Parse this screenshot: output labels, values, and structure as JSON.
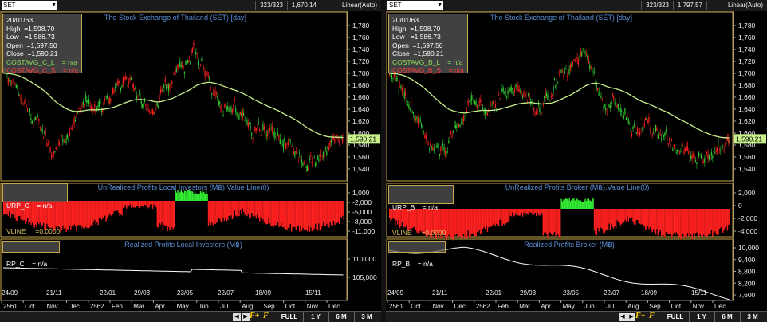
{
  "left": {
    "symbol": "SET",
    "count": "323/323",
    "last": "1,670.14",
    "scale": "Linear(Auto)",
    "main_title": "The Stock Exchange of Thailand (SET) [day]",
    "info": {
      "date": "20/01/63",
      "high": "High  =1,598.70",
      "low": "Low   =1,586.73",
      "open": "Open  =1,597.50",
      "close": "Close  =1,590.21",
      "avg_l": "COSTAVG_C_L    = n/a",
      "avg_s": "COSTAVG_C_S    = n/a"
    },
    "price_ticks": [
      "1,780",
      "1,760",
      "1,740",
      "1,720",
      "1,700",
      "1,680",
      "1,660",
      "1,640",
      "1,620",
      "1,600",
      "1,580",
      "1,560",
      "1,540"
    ],
    "price_tag": "1,590.21",
    "ind1_title": "UnRealized Profits Local Investors (M฿),Value Line(0)",
    "ind1_l1": "URP_C    = n/a",
    "ind1_l2": "VLINE     =0.0000",
    "ind1_ticks": [
      "1,000",
      "-2,000",
      "-5,000",
      "-8,000",
      "-11,000"
    ],
    "ind2_title": "Realized Profits Local Investors (M฿)",
    "ind2_l1": "RP_C    = n/a",
    "ind2_ticks": [
      "110,000",
      "105,000"
    ],
    "x_dates": [
      "24/09",
      "21/11",
      "22/01",
      "29/03",
      "23/05",
      "22/07",
      "18/09",
      "15/11"
    ],
    "x_months": [
      "2561",
      "Oct",
      "Nov",
      "Dec",
      "2562",
      "Feb",
      "Mar",
      "Apr",
      "May",
      "Jun",
      "Jul",
      "Aug",
      "Sep",
      "Oct",
      "Nov",
      "Dec"
    ],
    "chart_data": [
      {
        "type": "candlestick",
        "title": "The Stock Exchange of Thailand (SET) [day]",
        "ylim": [
          1530,
          1790
        ],
        "series": [
          {
            "name": "COSTAVG_C_L"
          }
        ]
      },
      {
        "type": "bar",
        "title": "UnRealized Profits Local Investors (M฿),Value Line(0)",
        "ylim": [
          -12000,
          2000
        ]
      },
      {
        "type": "line",
        "title": "Realized Profits Local Investors (M฿)",
        "ylim": [
          103000,
          113000
        ]
      }
    ]
  },
  "right": {
    "symbol": "SET",
    "count": "323/323",
    "last": "1,797.57",
    "scale": "Linear(Auto)",
    "main_title": "The Stock Exchange of Thailand (SET) [day]",
    "info": {
      "date": "20/01/63",
      "high": "High  =1,598.70",
      "low": "Low   =1,586.73",
      "open": "Open  =1,597.50",
      "close": "Close  =1,590.21",
      "avg_l": "COSTAVG_B_L    = n/a",
      "avg_s": "COSTAVG_B_S    = n/a"
    },
    "price_ticks": [
      "1,780",
      "1,760",
      "1,740",
      "1,720",
      "1,700",
      "1,680",
      "1,660",
      "1,640",
      "1,620",
      "1,600",
      "1,580",
      "1,560",
      "1,540"
    ],
    "price_tag": "1,590.21",
    "ind1_title": "UnRealized Profits Broker (M฿),Value Line(0)",
    "ind1_l1": "URP_B    = n/a",
    "ind1_l2": "VLINE     =0.0000",
    "ind1_ticks": [
      "2,000",
      "0",
      "-2,000",
      "-4,000"
    ],
    "ind2_title": "Realized Profits Broker (M฿)",
    "ind2_l1": "RP_B    = n/a",
    "ind2_ticks": [
      "10,000",
      "9,400",
      "8,800",
      "8,200",
      "7,600"
    ],
    "x_dates": [
      "24/09",
      "21/11",
      "22/01",
      "29/03",
      "23/05",
      "22/07",
      "18/09",
      "15/11"
    ],
    "x_months": [
      "2561",
      "Oct",
      "Nov",
      "Dec",
      "2562",
      "Feb",
      "Mar",
      "Apr",
      "May",
      "Jun",
      "Jul",
      "Aug",
      "Sep",
      "Oct",
      "Nov",
      "Dec"
    ],
    "chart_data": [
      {
        "type": "candlestick",
        "title": "The Stock Exchange of Thailand (SET) [day]",
        "ylim": [
          1530,
          1790
        ],
        "series": [
          {
            "name": "COSTAVG_B_L"
          }
        ]
      },
      {
        "type": "bar",
        "title": "UnRealized Profits Broker (M฿),Value Line(0)",
        "ylim": [
          -5000,
          3000
        ]
      },
      {
        "type": "line",
        "title": "Realized Profits Broker (M฿)",
        "ylim": [
          7300,
          10400
        ]
      }
    ]
  },
  "bottom": {
    "full": "FULL",
    "y1": "1 Y",
    "m6": "6 M",
    "m3": "3 M",
    "fplus": "F+",
    "fminus": "F-"
  },
  "colors": {
    "up": "#33cc33",
    "down": "#ff2020",
    "avg": "#c8f08a",
    "pos_bar": "#33ee33",
    "neg_bar": "#ff2020",
    "rp_line": "#ffffff",
    "title": "#5b8fd6"
  }
}
